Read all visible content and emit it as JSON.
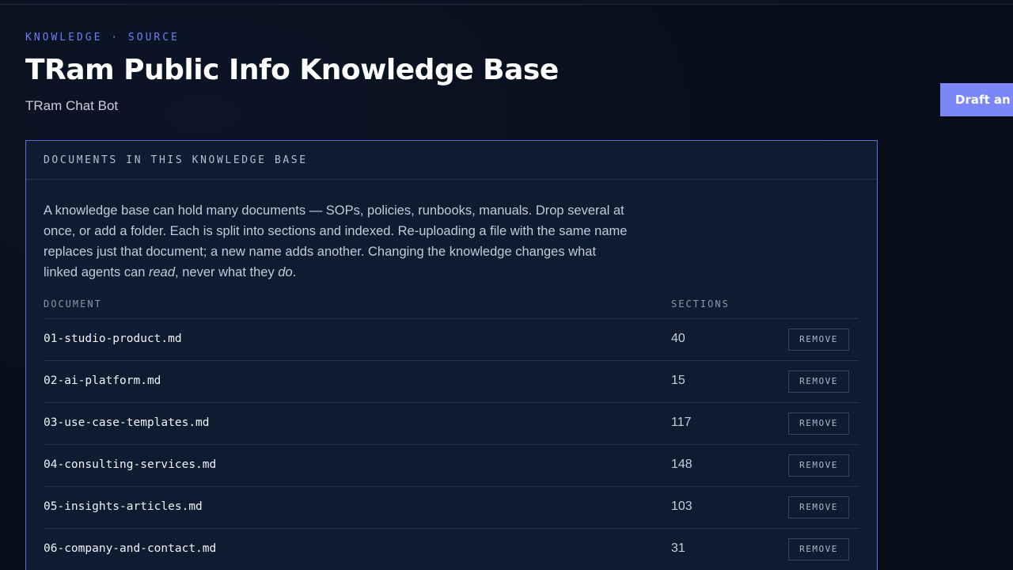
{
  "header": {
    "eyebrow": "KNOWLEDGE · SOURCE",
    "title": "TRam Public Info Knowledge Base",
    "subtitle": "TRam Chat Bot",
    "draft_button_label": "Draft an agent"
  },
  "panel": {
    "heading": "DOCUMENTS IN THIS KNOWLEDGE BASE",
    "description": {
      "part1": "A knowledge base can hold many documents — SOPs, policies, runbooks, manuals. Drop several at once, or add a folder. Each is split into sections and indexed. Re-uploading a file with the same name replaces just that document; a new name adds another. Changing the knowledge changes what linked agents can ",
      "em1": "read",
      "part2": ", never what they ",
      "em2": "do",
      "part3": "."
    },
    "table": {
      "columns": [
        "DOCUMENT",
        "SECTIONS"
      ],
      "remove_label": "REMOVE",
      "rows": [
        {
          "document": "01-studio-product.md",
          "sections": "40"
        },
        {
          "document": "02-ai-platform.md",
          "sections": "15"
        },
        {
          "document": "03-use-case-templates.md",
          "sections": "117"
        },
        {
          "document": "04-consulting-services.md",
          "sections": "148"
        },
        {
          "document": "05-insights-articles.md",
          "sections": "103"
        },
        {
          "document": "06-company-and-contact.md",
          "sections": "31"
        }
      ]
    }
  },
  "colors": {
    "accent": "#7b86f7",
    "eyebrow": "#6f7cf5",
    "background": "#070d18",
    "panel": "#0e1b30",
    "panel_border": "#5f6ce0"
  }
}
